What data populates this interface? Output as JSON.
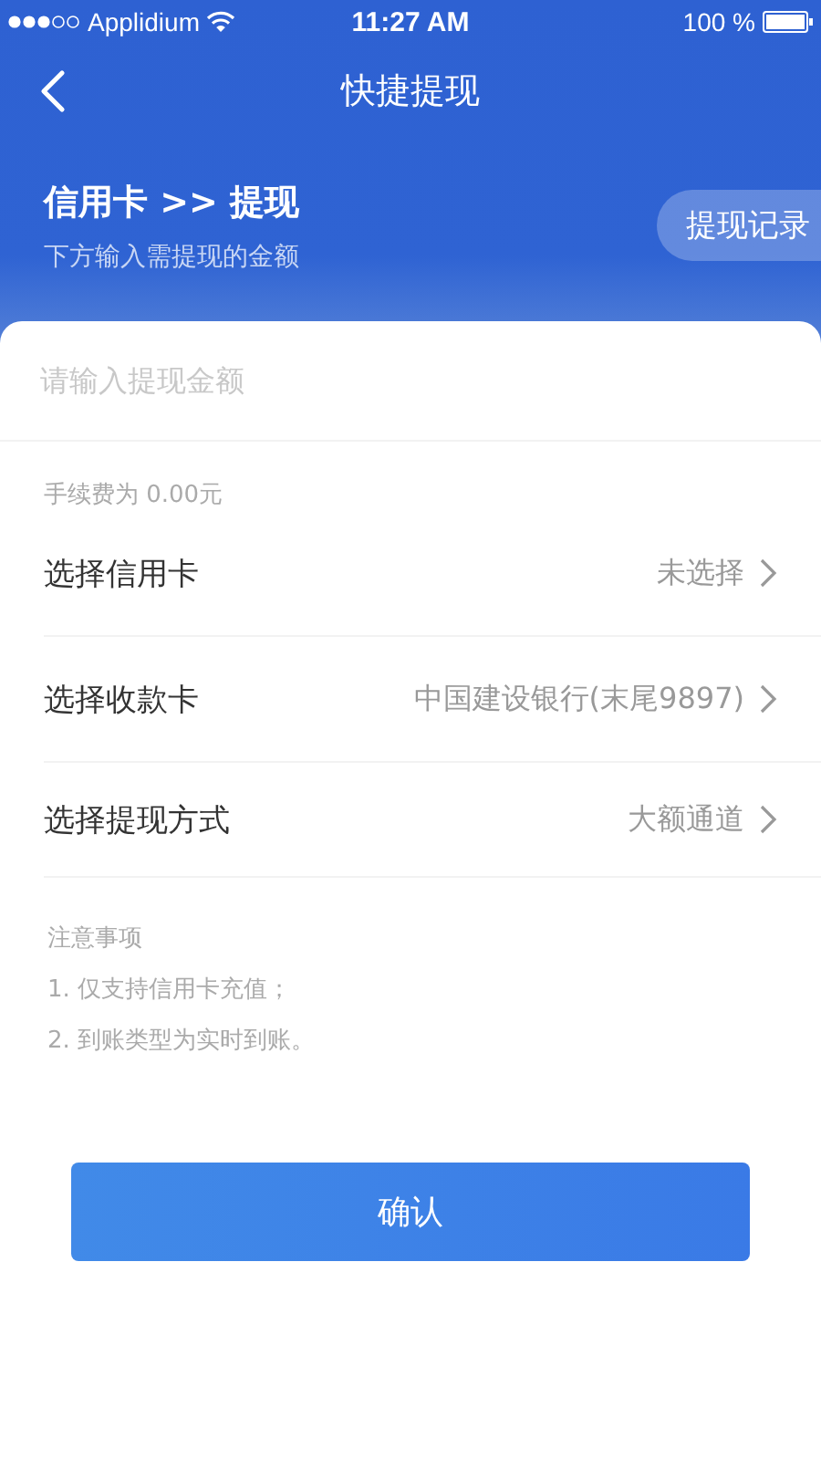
{
  "status_bar": {
    "carrier": "Applidium",
    "time": "11:27 AM",
    "battery": "100 %"
  },
  "nav": {
    "title": "快捷提现"
  },
  "header": {
    "title": "信用卡 >> 提现",
    "subtitle": "下方输入需提现的金额",
    "history_button": "提现记录"
  },
  "amount_field": {
    "placeholder": "请输入提现金额"
  },
  "fee": "手续费为 0.00元",
  "rows": [
    {
      "label": "选择信用卡",
      "value": "未选择"
    },
    {
      "label": "选择收款卡",
      "value": "中国建设银行(末尾9897)"
    },
    {
      "label": "选择提现方式",
      "value": "大额通道"
    }
  ],
  "notes": {
    "title": "注意事项",
    "items": [
      "1. 仅支持信用卡充值；",
      "2. 到账类型为实时到账。"
    ]
  },
  "confirm_button": "确认"
}
